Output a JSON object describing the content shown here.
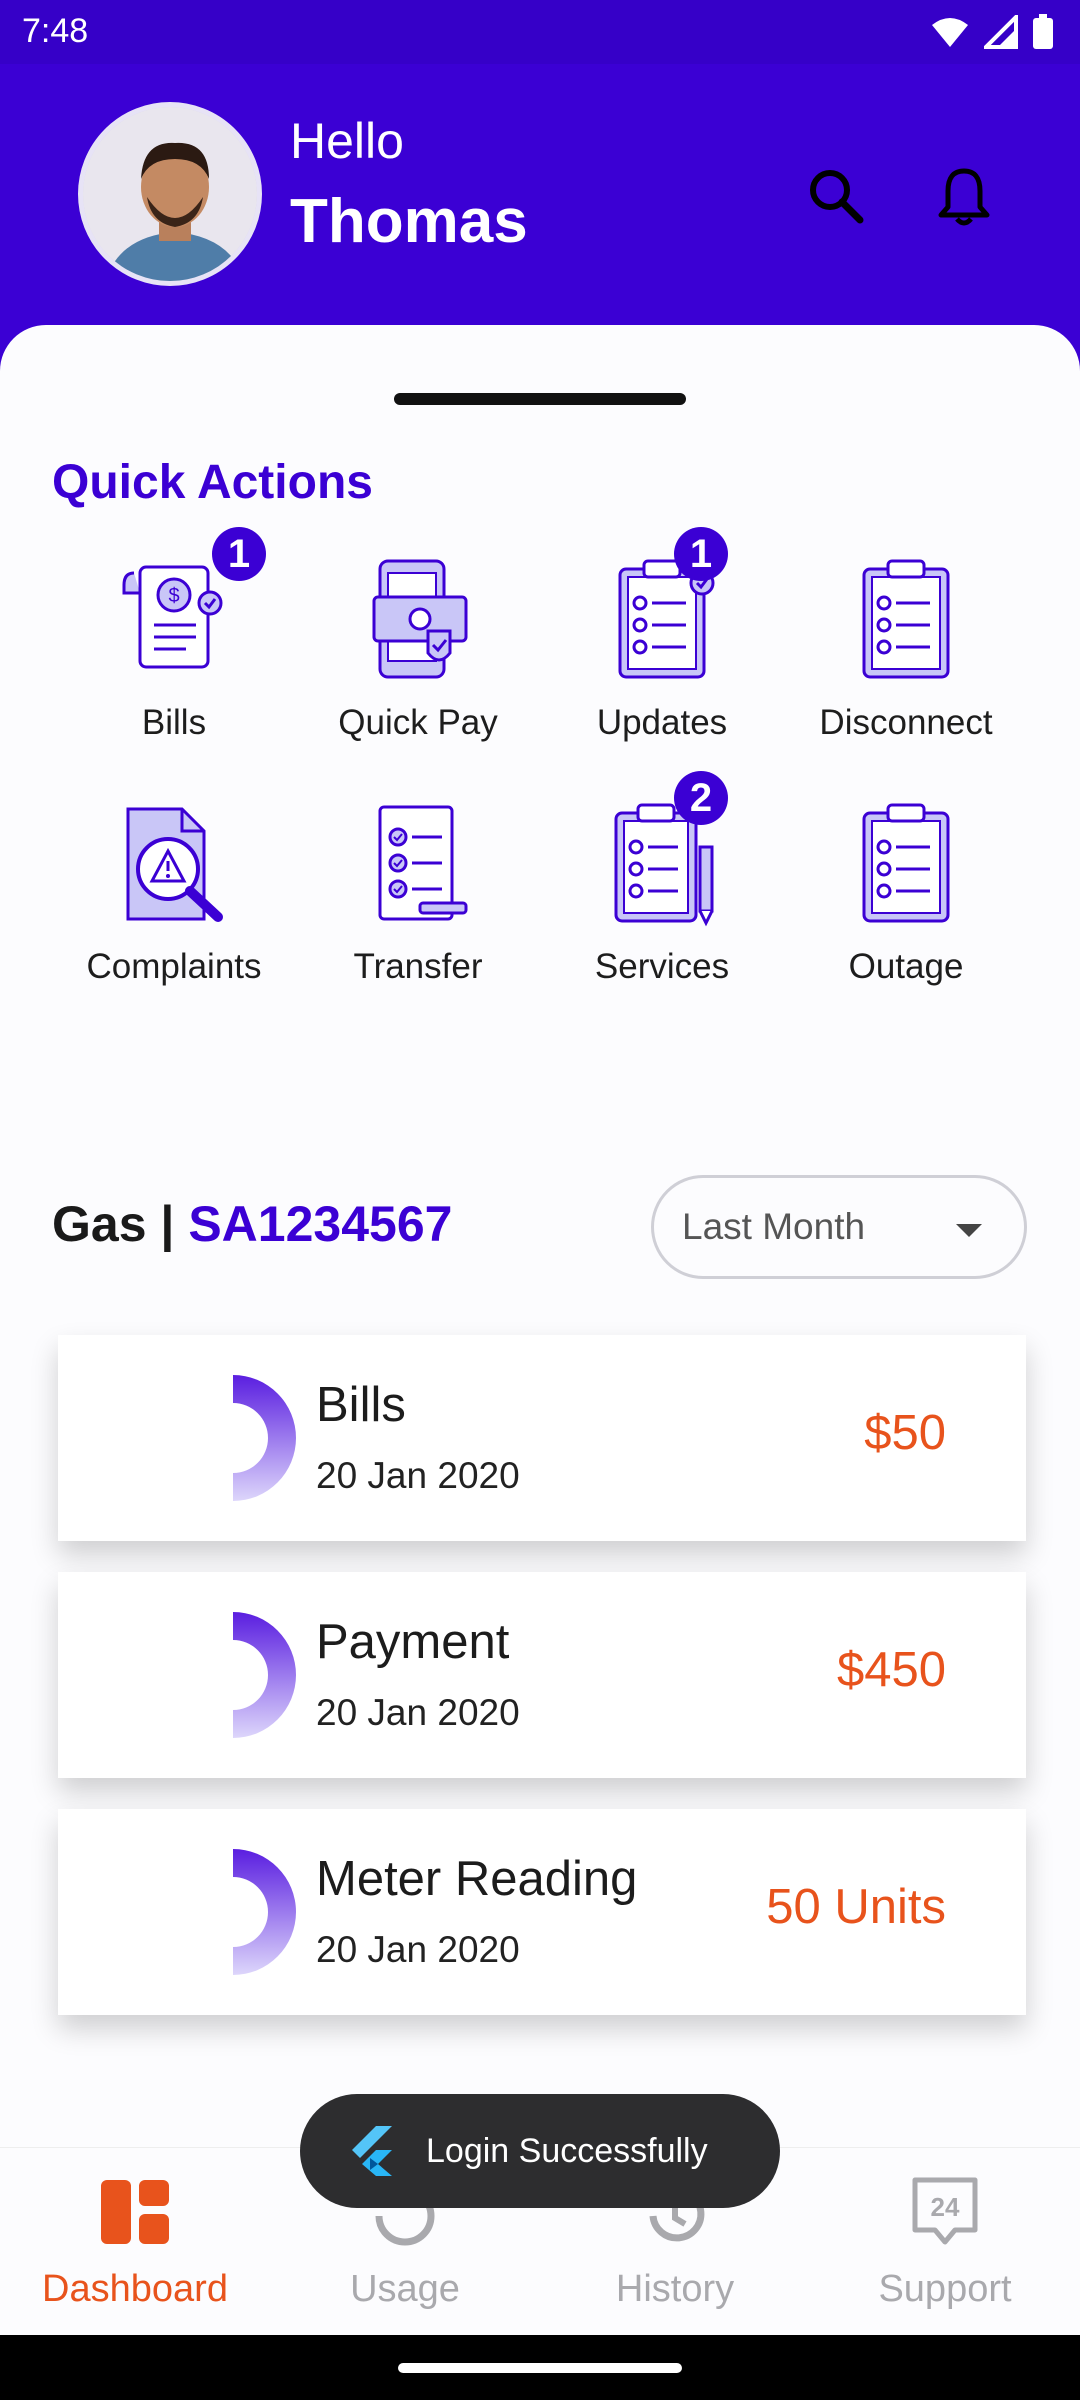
{
  "status_bar": {
    "time": "7:48"
  },
  "header": {
    "greeting": "Hello",
    "username": "Thomas"
  },
  "quick_actions": {
    "title": "Quick Actions",
    "items": [
      {
        "label": "Bills",
        "icon": "bill-receipt-icon",
        "badge": "1"
      },
      {
        "label": "Quick Pay",
        "icon": "mobile-pay-icon",
        "badge": ""
      },
      {
        "label": "Updates",
        "icon": "clipboard-check-icon",
        "badge": "1"
      },
      {
        "label": "Disconnect",
        "icon": "clipboard-list-icon",
        "badge": ""
      },
      {
        "label": "Complaints",
        "icon": "document-search-warning-icon",
        "badge": ""
      },
      {
        "label": "Transfer",
        "icon": "checklist-icon",
        "badge": ""
      },
      {
        "label": "Services",
        "icon": "clipboard-pencil-icon",
        "badge": "2"
      },
      {
        "label": "Outage",
        "icon": "clipboard-list-icon",
        "badge": ""
      }
    ]
  },
  "account": {
    "type": "Gas",
    "separator": "|",
    "number": "SA1234567",
    "period": "Last Month"
  },
  "cards": [
    {
      "title": "Bills",
      "date": "20 Jan 2020",
      "value": "$50"
    },
    {
      "title": "Payment",
      "date": "20 Jan 2020",
      "value": "$450"
    },
    {
      "title": "Meter Reading",
      "date": "20 Jan 2020",
      "value": "50 Units"
    }
  ],
  "toast": {
    "message": "Login Successfully"
  },
  "bottom_nav": {
    "items": [
      {
        "label": "Dashboard",
        "icon": "dashboard-icon",
        "active": true
      },
      {
        "label": "Usage",
        "icon": "usage-icon",
        "active": false
      },
      {
        "label": "History",
        "icon": "history-icon",
        "active": false
      },
      {
        "label": "Support",
        "icon": "support-24-icon",
        "active": false,
        "icon_text": "24"
      }
    ]
  },
  "colors": {
    "primary": "#3b00d4",
    "accent": "#e8531c",
    "icon_fill": "#c9c6f7"
  }
}
